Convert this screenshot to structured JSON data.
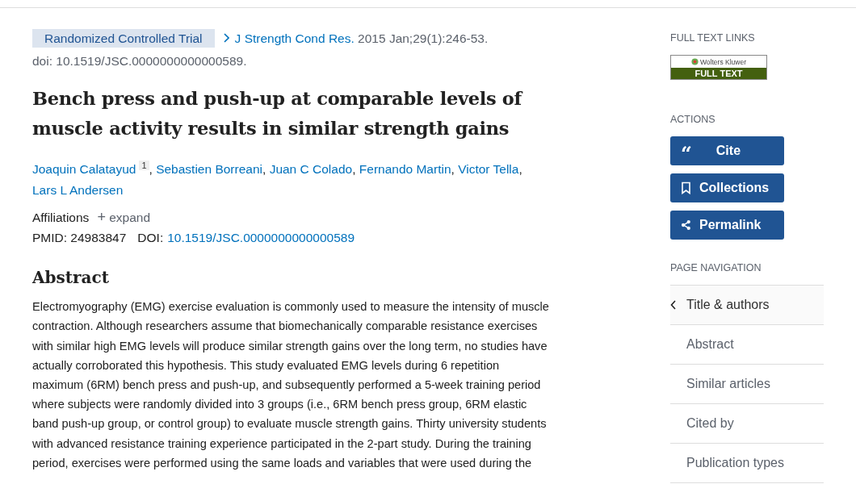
{
  "article": {
    "publication_type": "Randomized Controlled Trial",
    "journal": "J Strength Cond Res.",
    "citation": "2015 Jan;29(1):246-53.",
    "doi_line": "doi: 10.1519/JSC.0000000000000589.",
    "title": "Bench press and push-up at comparable levels of muscle activity results in similar strength gains",
    "authors": [
      {
        "name": "Joaquin Calatayud",
        "sup": "1",
        "sep": ","
      },
      {
        "name": "Sebastien Borreani",
        "sep": ","
      },
      {
        "name": "Juan C Colado",
        "sep": ","
      },
      {
        "name": "Fernando Martin",
        "sep": ","
      },
      {
        "name": "Victor Tella",
        "sep": ","
      },
      {
        "name": "Lars L Andersen"
      }
    ],
    "affiliations": {
      "label": "Affiliations",
      "toggle_icon": "+",
      "toggle": "expand"
    },
    "pmid_label": "PMID:",
    "pmid": "24983847",
    "doi_label": "DOI:",
    "doi": "10.1519/JSC.0000000000000589",
    "abstract_heading": "Abstract",
    "abstract_lines": [
      "Electromyography (EMG) exercise evaluation is commonly used to measure the intensity of muscle",
      "contraction. Although researchers assume that biomechanically comparable resistance exercises",
      "with similar high EMG levels will produce similar strength gains over the long term, no studies have",
      "actually corroborated this hypothesis. This study evaluated EMG levels during 6 repetition",
      "maximum (6RM) bench press and push-up, and subsequently performed a 5-week training period",
      "where subjects were randomly divided into 3 groups (i.e., 6RM bench press group, 6RM elastic",
      "band push-up group, or control group) to evaluate muscle strength gains. Thirty university students",
      "with advanced resistance training experience participated in the 2-part study. During the training",
      "period, exercises were performed using the same loads and variables that were used during the"
    ]
  },
  "sidebar": {
    "full_text_heading": "FULL TEXT LINKS",
    "full_text_link": {
      "brand": "Wolters Kluwer",
      "label": "FULL TEXT"
    },
    "actions_heading": "ACTIONS",
    "actions": [
      {
        "kind": "quote",
        "icon_text": "“",
        "label": "Cite"
      },
      {
        "kind": "bookmark",
        "label": "Collections"
      },
      {
        "kind": "share",
        "label": "Permalink"
      }
    ],
    "navigation_heading": "PAGE NAVIGATION",
    "navigation": [
      {
        "label": "Title & authors",
        "selected": true
      },
      {
        "label": "Abstract",
        "selected": false
      },
      {
        "label": "Similar articles",
        "selected": false
      },
      {
        "label": "Cited by",
        "selected": false
      },
      {
        "label": "Publication types",
        "selected": false
      }
    ]
  }
}
